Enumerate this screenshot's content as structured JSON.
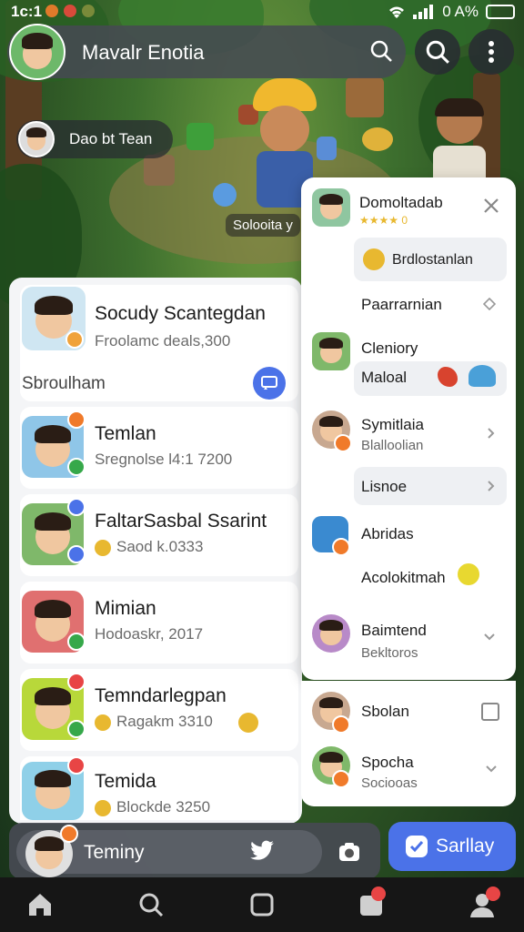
{
  "status_bar": {
    "time": "1c:1",
    "battery": "0 A%"
  },
  "header": {
    "title": "Mavalr Enotia"
  },
  "chip": {
    "label": "Dao bt Tean"
  },
  "scene": {
    "sign": "Solooita y"
  },
  "left_panel": {
    "profile": {
      "name": "Socudy Scantegdan",
      "sub": "Froolamc deals,300"
    },
    "section": {
      "label": "Sbroulham"
    },
    "items": [
      {
        "name": "Temlan",
        "sub": "Sregnolse l4:1 7200"
      },
      {
        "name": "FaltarSasbal Ssarint",
        "sub": "Saod k.0333"
      },
      {
        "name": "Mimian",
        "sub": "Hodoaskr, 2017"
      },
      {
        "name": "Temndarlegpan",
        "sub": "Ragakm 3310"
      },
      {
        "name": "Temida",
        "sub": "Blockde 3250"
      }
    ]
  },
  "right_panel": {
    "header": {
      "name": "Domoltadab",
      "rating": "★★★★ 0"
    },
    "entries": [
      {
        "label": "Brdlostanlan"
      },
      {
        "label": "Paarrarnian"
      },
      {
        "label": "Cleniory"
      },
      {
        "label": "Maloal"
      },
      {
        "label": "Symitlaia"
      },
      {
        "label": "Blalloolian"
      },
      {
        "label": "Lisnoe"
      },
      {
        "label": "Abridas"
      },
      {
        "label": "Acolokitmah"
      },
      {
        "label": "Baimtend"
      },
      {
        "label": "Bekltoros"
      },
      {
        "label": "Sbolan"
      },
      {
        "label": "Spocha"
      },
      {
        "label": "Sociooas"
      }
    ]
  },
  "bottom": {
    "label": "Teminy",
    "cta": "Sarllay"
  },
  "colors": {
    "accent": "#4b72e8",
    "badge_green": "#36a84a",
    "badge_orange": "#f07a2a",
    "badge_red": "#e84545"
  }
}
